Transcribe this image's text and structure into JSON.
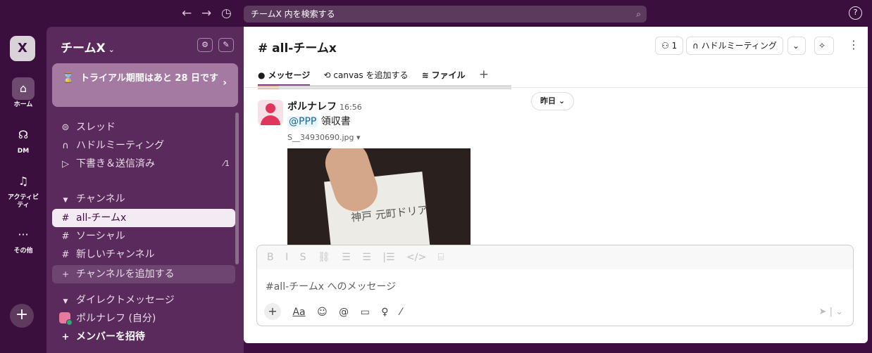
{
  "topbar": {
    "back": "←",
    "forward": "→",
    "history": "◷",
    "search_placeholder": "チームX 内を検索する",
    "help": "?"
  },
  "rail": {
    "workspace_initial": "X",
    "items": [
      {
        "label": "ホーム",
        "icon": "home-icon"
      },
      {
        "label": "DM",
        "icon": "dm-icon"
      },
      {
        "label": "アクティビティ",
        "icon": "bell-icon"
      },
      {
        "label": "その他",
        "icon": "more-icon"
      }
    ],
    "add": "+"
  },
  "sidebar": {
    "workspace_name": "チームX",
    "trial_text": "トライアル期間はあと 28 日です",
    "nav": [
      {
        "label": "スレッド",
        "icon": "⊜"
      },
      {
        "label": "ハドルミーティング",
        "icon": "∩"
      },
      {
        "label": "下書き＆送信済み",
        "icon": "▷",
        "count": "1"
      }
    ],
    "channels_header": "チャンネル",
    "channels": [
      "all-チームx",
      "ソーシャル",
      "新しいチャンネル"
    ],
    "add_channel": "チャンネルを追加する",
    "dm_header": "ダイレクトメッセージ",
    "dm_self": "ポルナレフ (自分)",
    "invite": "メンバーを招待"
  },
  "main": {
    "channel_title": "# all-チームx",
    "member_count": "1",
    "huddle_label": "ハドルミーティング",
    "tabs": [
      {
        "label": "メッセージ",
        "icon": "●"
      },
      {
        "label": "canvas を追加する",
        "icon": "⟲"
      },
      {
        "label": "ファイル",
        "icon": "≋"
      }
    ],
    "date_pill": "昨日",
    "message": {
      "author": "ポルナレフ",
      "time": "16:56",
      "mention": "@PPP",
      "text": "領収書",
      "file_name": "S__34930690.jpg"
    },
    "photo_text": "神戸 元町ドリア",
    "composer": {
      "placeholder": "#all-チームx へのメッセージ",
      "format": [
        "B",
        "I",
        "S",
        "⛓",
        "☰",
        "☰",
        "|☰",
        "</>",
        "⌸"
      ],
      "tools": [
        "Aa",
        "☺",
        "@",
        "▭",
        "♀",
        "⁄"
      ]
    }
  }
}
